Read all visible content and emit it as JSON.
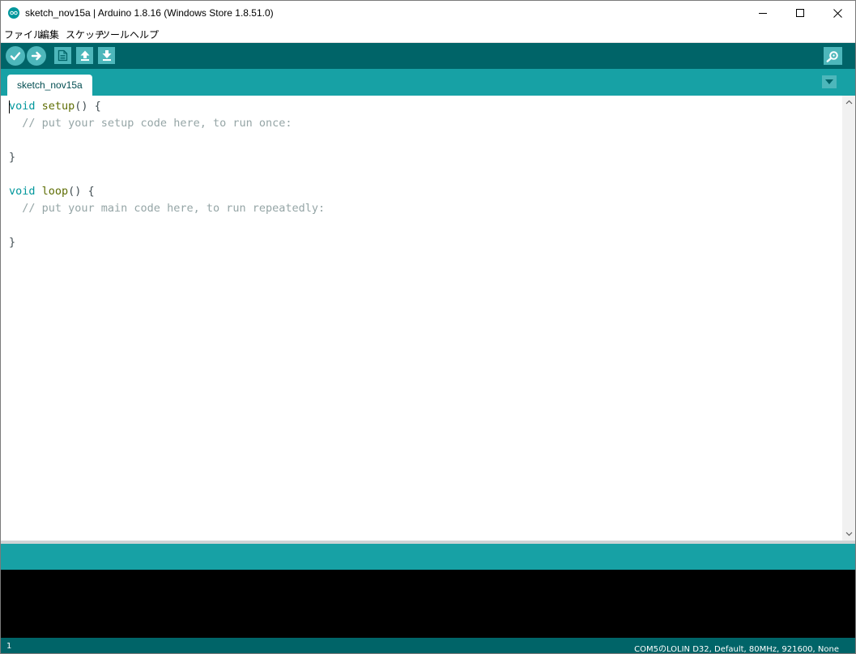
{
  "window": {
    "title": "sketch_nov15a | Arduino 1.8.16 (Windows Store 1.8.51.0)"
  },
  "menu": [
    {
      "label": "ファイル"
    },
    {
      "label": "編集"
    },
    {
      "label": "スケッチ"
    },
    {
      "label": "ツール"
    },
    {
      "label": "ヘルプ"
    }
  ],
  "tab": {
    "label": "sketch_nov15a"
  },
  "editor": {
    "code": {
      "l1_kw": "void",
      "l1_fn": "setup",
      "l1_rest": "() {",
      "l2_comment": "  // put your setup code here, to run once:",
      "l4": "}",
      "l6_kw": "void",
      "l6_fn": "loop",
      "l6_rest": "() {",
      "l7_comment": "  // put your main code here, to run repeatedly:",
      "l9": "}"
    }
  },
  "status": {
    "line_number": "1",
    "board": "COM5のLOLIN D32, Default, 80MHz, 921600, None"
  },
  "icons": {
    "verify": "checkmark-icon",
    "upload": "arrow-right-icon",
    "new": "new-file-icon",
    "open": "open-arrow-up-icon",
    "save": "save-arrow-down-icon",
    "serial_monitor": "magnifier-icon",
    "tab_menu": "chevron-down-icon"
  },
  "colors": {
    "toolbar": "#006468",
    "tabbar": "#17a1a5",
    "button": "#4db7bb",
    "keyword": "#00979c",
    "function": "#5e6d03",
    "comment": "#95a5a6",
    "console": "#000000"
  }
}
